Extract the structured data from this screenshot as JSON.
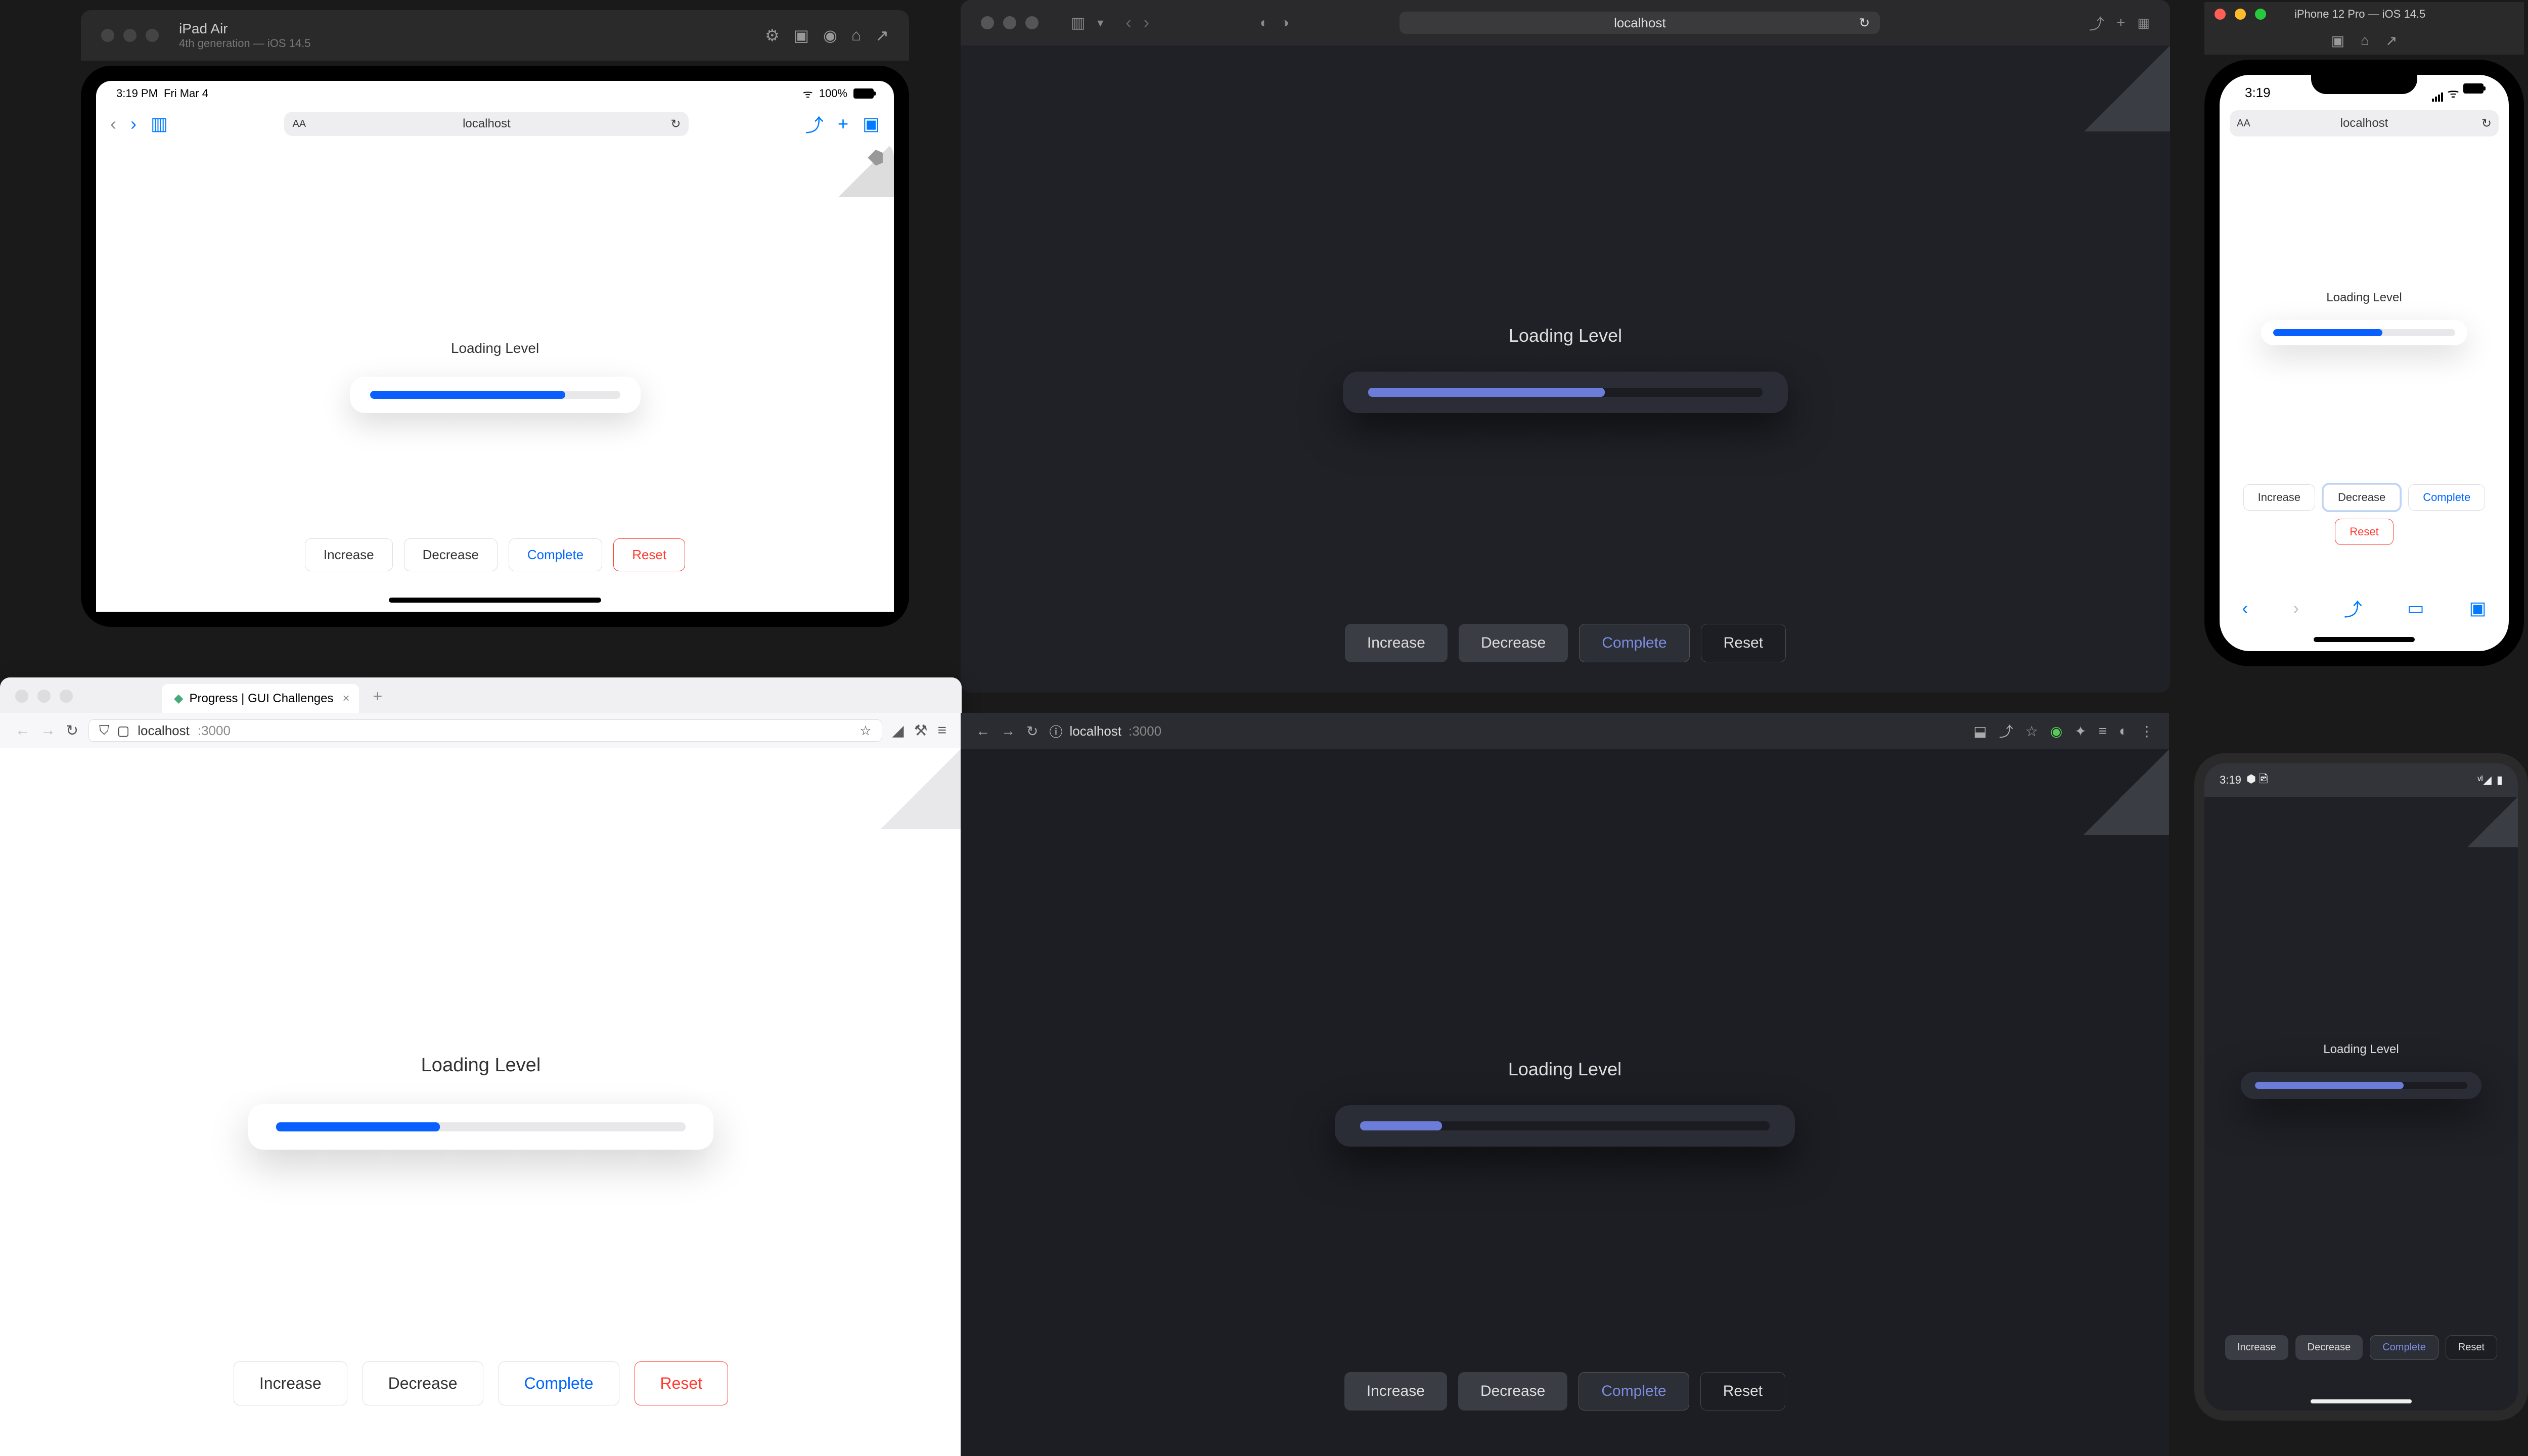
{
  "app": {
    "loading_label": "Loading Level",
    "buttons": {
      "increase": "Increase",
      "decrease": "Decrease",
      "complete": "Complete",
      "reset": "Reset"
    }
  },
  "ipad_sim": {
    "device_name": "iPad Air",
    "device_sub": "4th generation — iOS 14.5",
    "status_time": "3:19 PM",
    "status_date": "Fri Mar 4",
    "battery": "100%",
    "url": "localhost",
    "progress": 78
  },
  "safari_desktop": {
    "url": "localhost",
    "progress": 60
  },
  "iphone_sim": {
    "titlebar": "iPhone 12 Pro — iOS 14.5",
    "status_time": "3:19",
    "url": "localhost",
    "progress": 60
  },
  "firefox": {
    "tab_title": "Progress | GUI Challenges",
    "url_host": "localhost",
    "url_port": ":3000",
    "progress": 40
  },
  "chrome_dark": {
    "url_host": "localhost",
    "url_port": ":3000",
    "progress": 20
  },
  "android": {
    "status_time": "3:19",
    "progress": 70
  }
}
